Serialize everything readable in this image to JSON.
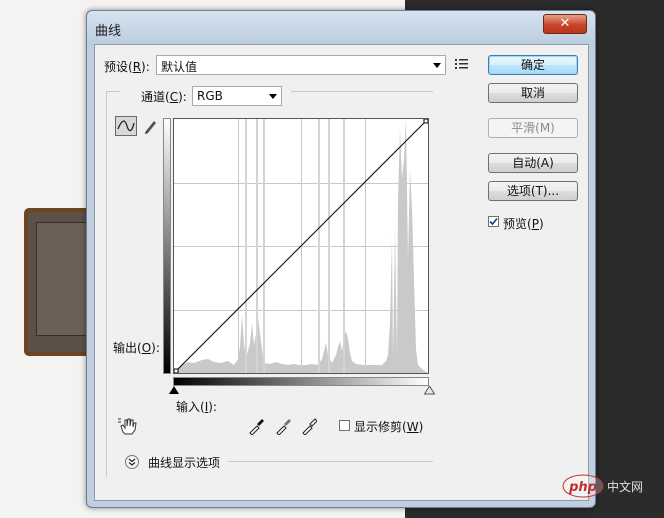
{
  "dialog": {
    "title": "曲线",
    "close_glyph": "✕"
  },
  "preset": {
    "label_prefix": "预设(",
    "label_key": "R",
    "label_suffix": "):",
    "value": "默认值"
  },
  "channel": {
    "label_prefix": "通道(",
    "label_key": "C",
    "label_suffix": "):",
    "value": "RGB"
  },
  "buttons": {
    "ok": "确定",
    "cancel": "取消",
    "smooth": "平滑(M)",
    "auto": "自动(A)",
    "options": "选项(T)..."
  },
  "preview": {
    "label_prefix": "预览(",
    "label_key": "P",
    "label_suffix": ")",
    "checked": true
  },
  "output_label": {
    "prefix": "输出(",
    "key": "O",
    "suffix": "):"
  },
  "input_label": {
    "prefix": "输入(",
    "key": "I",
    "suffix": "):"
  },
  "show_clipping": {
    "prefix": "显示修剪(",
    "key": "W",
    "suffix": ")",
    "checked": false
  },
  "curve_options": {
    "label": "曲线显示选项"
  },
  "watermark": {
    "text": "php 中文网"
  },
  "colors": {
    "accent_button": "#a7d9f5",
    "histogram": "#c9c9c9",
    "close_button": "#c8452a"
  }
}
